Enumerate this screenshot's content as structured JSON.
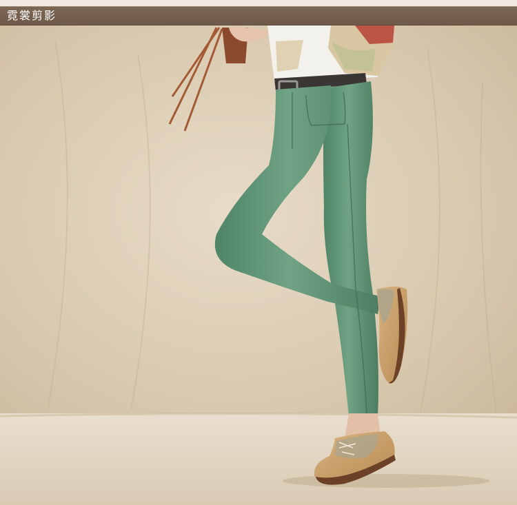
{
  "header": {
    "title": "霓裳剪影"
  },
  "colors": {
    "header_bar": "#735e4d",
    "backdrop": "#dccdb5",
    "jeans": "#5f9476",
    "shoe_tan": "#c9a06b",
    "shoe_brown": "#6b4227",
    "shirt": "#f3f1ec"
  }
}
